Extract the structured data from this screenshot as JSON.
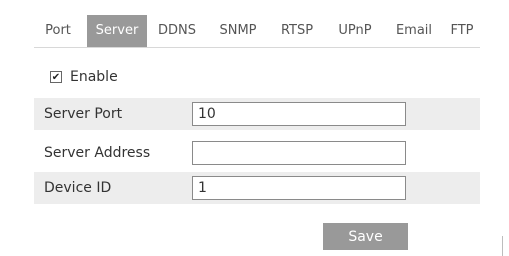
{
  "tabs": [
    {
      "label": "Port",
      "active": false
    },
    {
      "label": "Server",
      "active": true
    },
    {
      "label": "DDNS",
      "active": false
    },
    {
      "label": "SNMP",
      "active": false
    },
    {
      "label": "RTSP",
      "active": false
    },
    {
      "label": "UPnP",
      "active": false
    },
    {
      "label": "Email",
      "active": false
    },
    {
      "label": "FTP",
      "active": false
    }
  ],
  "enable": {
    "label": "Enable",
    "checked": true
  },
  "fields": [
    {
      "label": "Server Port",
      "value": "10"
    },
    {
      "label": "Server Address",
      "value": ""
    },
    {
      "label": "Device ID",
      "value": "1"
    }
  ],
  "save_label": "Save",
  "colors": {
    "active_tab_bg": "#999999",
    "button_bg": "#999999",
    "row_alt_bg": "#ededed"
  }
}
